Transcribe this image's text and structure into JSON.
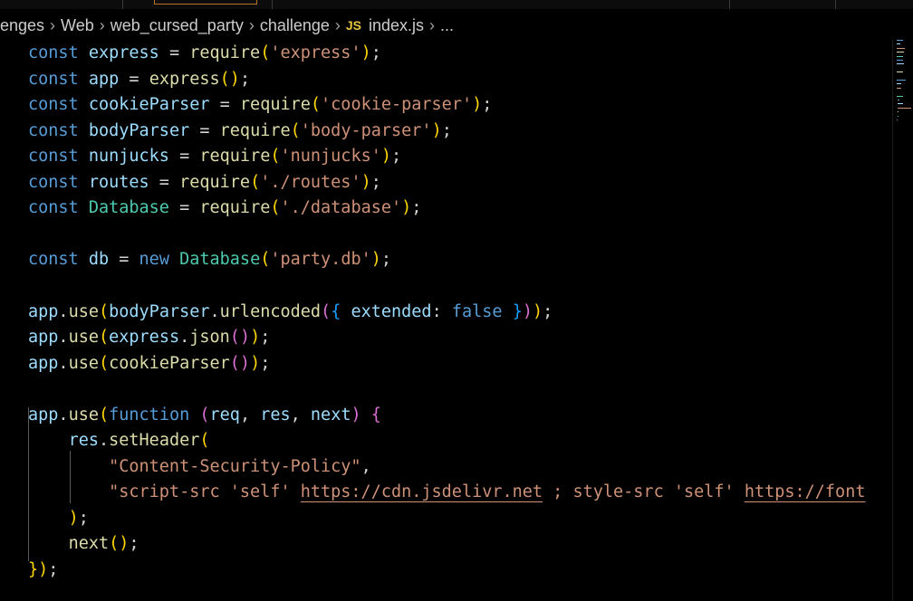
{
  "breadcrumb": {
    "items": [
      "enges",
      "Web",
      "web_cursed_party",
      "challenge"
    ],
    "file_badge": "JS",
    "file_name": "index.js",
    "more": "..."
  },
  "editor": {
    "language": "javascript",
    "lines": [
      "const express = require('express');",
      "const app = express();",
      "const cookieParser = require('cookie-parser');",
      "const bodyParser = require('body-parser');",
      "const nunjucks = require('nunjucks');",
      "const routes = require('./routes');",
      "const Database = require('./database');",
      "",
      "const db = new Database('party.db');",
      "",
      "app.use(bodyParser.urlencoded({ extended: false }));",
      "app.use(express.json());",
      "app.use(cookieParser());",
      "",
      "app.use(function (req, res, next) {",
      "    res.setHeader(",
      "        \"Content-Security-Policy\",",
      "        \"script-src 'self' https://cdn.jsdelivr.net ; style-src 'self' https://font",
      "    );",
      "    next();",
      "});"
    ]
  },
  "colors": {
    "keyword": "#569cd6",
    "variable": "#9cdcfe",
    "function": "#dcdcaa",
    "string": "#ce9178",
    "class": "#4ec9b0",
    "bracket_1": "#ffd700",
    "bracket_2": "#da70d6",
    "bracket_3": "#179fff",
    "background": "#000000"
  }
}
